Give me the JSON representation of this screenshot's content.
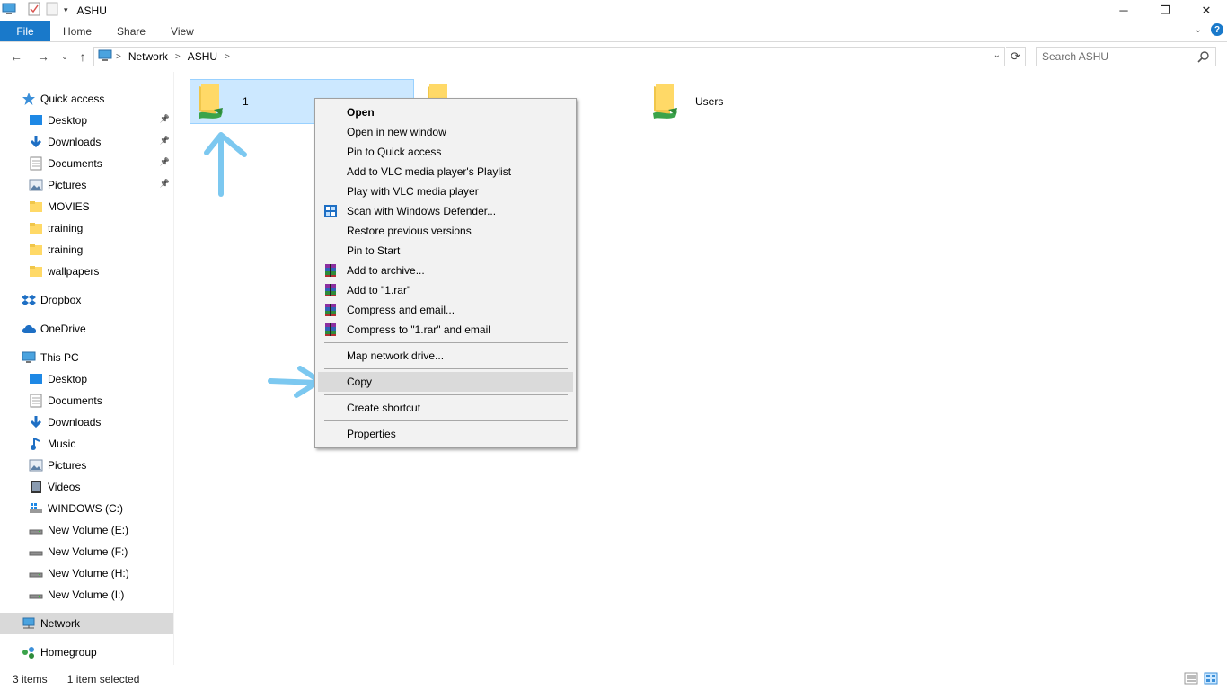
{
  "window": {
    "title": "ASHU",
    "controls": {
      "minimize": "─",
      "restore": "❐",
      "close": "✕"
    }
  },
  "ribbon": {
    "tabs": [
      "File",
      "Home",
      "Share",
      "View"
    ]
  },
  "address": {
    "crumbs": [
      "Network",
      "ASHU"
    ],
    "search_placeholder": "Search ASHU"
  },
  "sidebar": {
    "items": [
      {
        "label": "Quick access",
        "icon": "star-icon",
        "pinned": false,
        "indent": false
      },
      {
        "label": "Desktop",
        "icon": "desktop-icon",
        "pinned": true,
        "indent": true
      },
      {
        "label": "Downloads",
        "icon": "download-icon",
        "pinned": true,
        "indent": true
      },
      {
        "label": "Documents",
        "icon": "documents-icon",
        "pinned": true,
        "indent": true
      },
      {
        "label": "Pictures",
        "icon": "pictures-icon",
        "pinned": true,
        "indent": true
      },
      {
        "label": "MOVIES",
        "icon": "folder-icon",
        "pinned": false,
        "indent": true
      },
      {
        "label": "training",
        "icon": "folder-icon",
        "pinned": false,
        "indent": true
      },
      {
        "label": "training",
        "icon": "folder-icon",
        "pinned": false,
        "indent": true
      },
      {
        "label": "wallpapers",
        "icon": "folder-icon",
        "pinned": false,
        "indent": true
      },
      {
        "label": "Dropbox",
        "icon": "dropbox-icon",
        "pinned": false,
        "indent": false
      },
      {
        "label": "OneDrive",
        "icon": "onedrive-icon",
        "pinned": false,
        "indent": false
      },
      {
        "label": "This PC",
        "icon": "pc-icon",
        "pinned": false,
        "indent": false
      },
      {
        "label": "Desktop",
        "icon": "desktop-icon",
        "pinned": false,
        "indent": true
      },
      {
        "label": "Documents",
        "icon": "documents-icon",
        "pinned": false,
        "indent": true
      },
      {
        "label": "Downloads",
        "icon": "download-icon",
        "pinned": false,
        "indent": true
      },
      {
        "label": "Music",
        "icon": "music-icon",
        "pinned": false,
        "indent": true
      },
      {
        "label": "Pictures",
        "icon": "pictures-icon",
        "pinned": false,
        "indent": true
      },
      {
        "label": "Videos",
        "icon": "videos-icon",
        "pinned": false,
        "indent": true
      },
      {
        "label": "WINDOWS (C:)",
        "icon": "windows-drive-icon",
        "pinned": false,
        "indent": true
      },
      {
        "label": "New Volume (E:)",
        "icon": "drive-icon",
        "pinned": false,
        "indent": true
      },
      {
        "label": "New Volume (F:)",
        "icon": "drive-icon",
        "pinned": false,
        "indent": true
      },
      {
        "label": "New Volume (H:)",
        "icon": "drive-icon",
        "pinned": false,
        "indent": true
      },
      {
        "label": "New Volume (I:)",
        "icon": "drive-icon",
        "pinned": false,
        "indent": true
      },
      {
        "label": "Network",
        "icon": "network-icon",
        "pinned": false,
        "indent": false,
        "selected": true
      },
      {
        "label": "Homegroup",
        "icon": "homegroup-icon",
        "pinned": false,
        "indent": false
      }
    ]
  },
  "content": {
    "items": [
      {
        "label": "1",
        "selected": true,
        "icon": "shared-folder-icon"
      },
      {
        "label": "",
        "selected": false,
        "icon": "shared-folder-icon"
      },
      {
        "label": "Users",
        "selected": false,
        "icon": "shared-folder-icon"
      }
    ]
  },
  "context_menu": {
    "items": [
      {
        "label": "Open",
        "bold": true,
        "icon": ""
      },
      {
        "label": "Open in new window",
        "icon": ""
      },
      {
        "label": "Pin to Quick access",
        "icon": ""
      },
      {
        "label": "Add to VLC media player's Playlist",
        "icon": ""
      },
      {
        "label": "Play with VLC media player",
        "icon": ""
      },
      {
        "label": "Scan with Windows Defender...",
        "icon": "defender-icon"
      },
      {
        "label": "Restore previous versions",
        "icon": ""
      },
      {
        "label": "Pin to Start",
        "icon": ""
      },
      {
        "label": "Add to archive...",
        "icon": "winrar-icon"
      },
      {
        "label": "Add to \"1.rar\"",
        "icon": "winrar-icon"
      },
      {
        "label": "Compress and email...",
        "icon": "winrar-icon"
      },
      {
        "label": "Compress to \"1.rar\" and email",
        "icon": "winrar-icon"
      },
      {
        "label": "Map network drive...",
        "icon": ""
      },
      {
        "label": "Copy",
        "icon": "",
        "hover": true
      },
      {
        "label": "Create shortcut",
        "icon": ""
      },
      {
        "label": "Properties",
        "icon": ""
      }
    ]
  },
  "statusbar": {
    "item_count": "3 items",
    "selection": "1 item selected"
  },
  "colors": {
    "accent": "#1979ca",
    "selection": "#cce8ff",
    "annotation": "#7cc8f0"
  }
}
